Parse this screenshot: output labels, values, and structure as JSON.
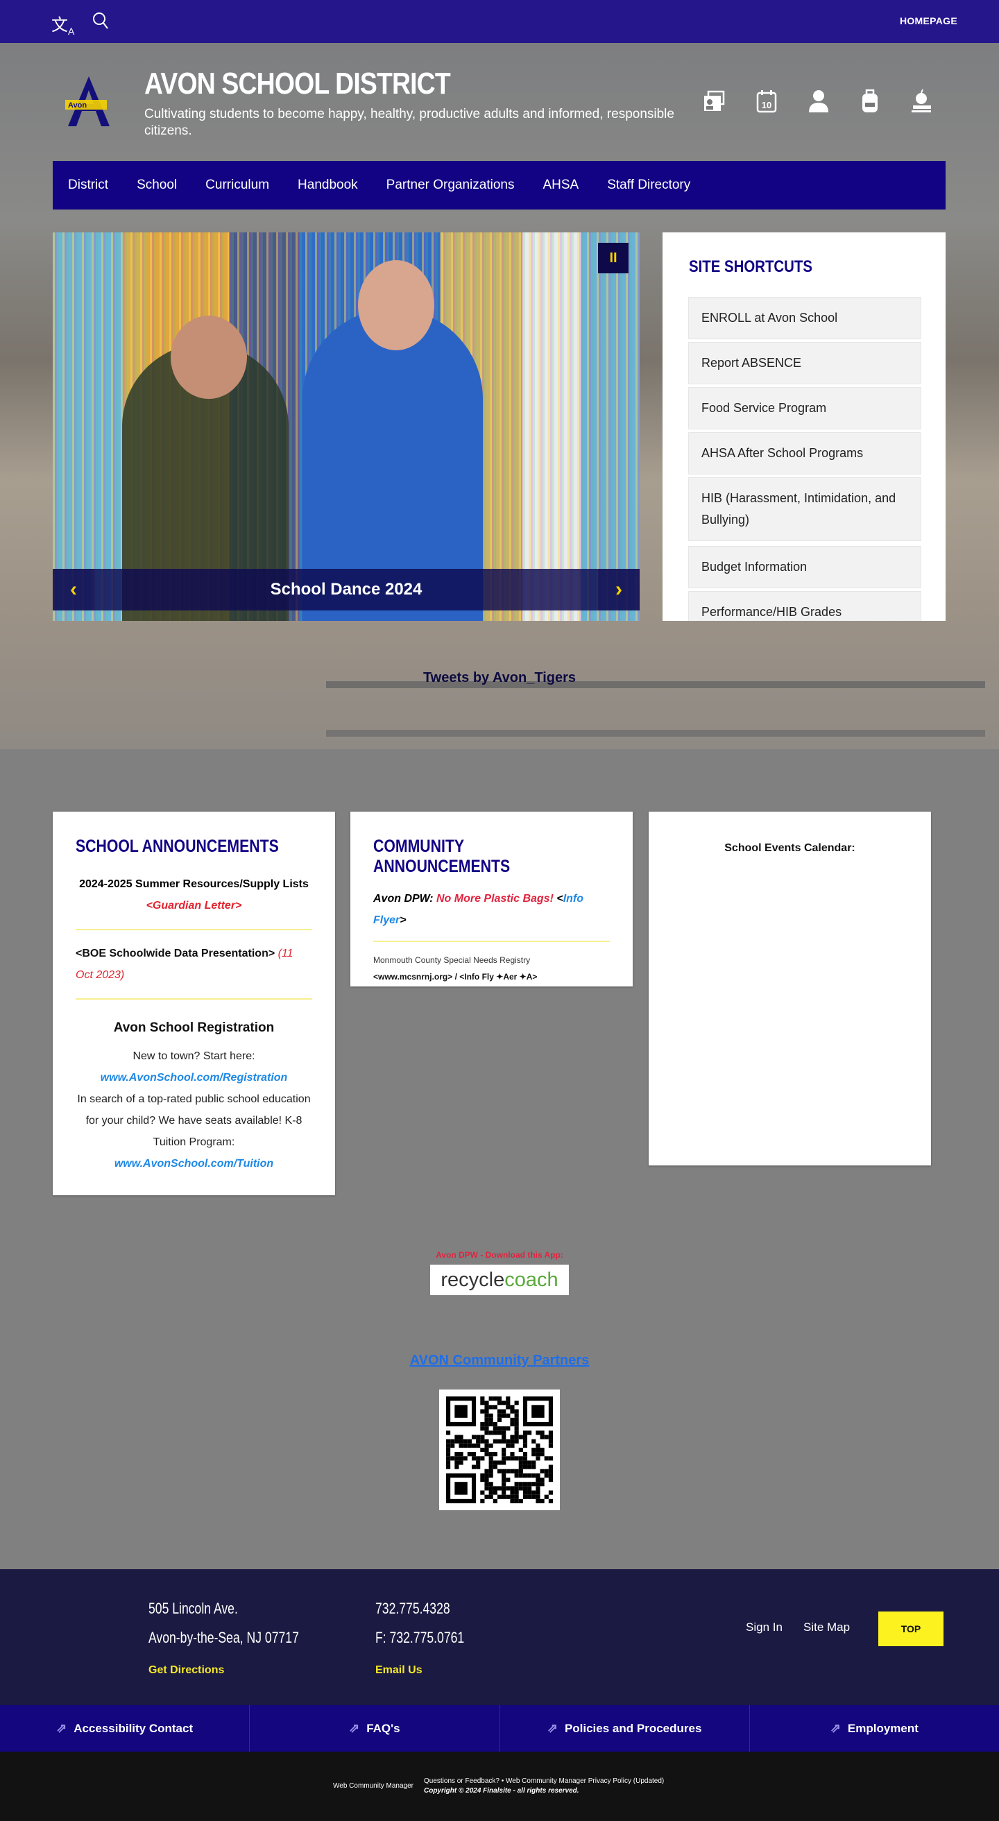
{
  "topbar": {
    "homepage": "HOMEPAGE",
    "icons": [
      "translate-icon",
      "search-icon"
    ]
  },
  "header": {
    "title": "AVON SCHOOL DISTRICT",
    "tagline": "Cultivating students to become happy, healthy, productive adults and informed, responsible citizens.",
    "logo_letter": "A",
    "logo_text": "Avon",
    "icons": [
      "directory-icon",
      "calendar-icon",
      "user-icon",
      "backpack-icon",
      "teacher-icon"
    ],
    "calendar_day": "10"
  },
  "nav": [
    "District",
    "School",
    "Curriculum",
    "Handbook",
    "Partner Organizations",
    "AHSA",
    "Staff Directory"
  ],
  "slider": {
    "caption": "School Dance 2024",
    "pause": "II",
    "prev": "‹",
    "next": "›"
  },
  "shortcuts": {
    "title": "SITE SHORTCUTS",
    "items": [
      "ENROLL at Avon School",
      "Report ABSENCE",
      "Food Service Program",
      "AHSA After School Programs",
      "HIB (Harassment, Intimidation, and Bullying)",
      "Budget Information",
      "Performance/HIB Grades"
    ]
  },
  "tweets": "Tweets by Avon_Tigers",
  "school_announcements": {
    "title": "SCHOOL ANNOUNCEMENTS",
    "supply": "2024-2025 Summer Resources/Supply Lists",
    "guardian": "<Guardian Letter>",
    "boe": "<BOE Schoolwide Data Presentation>",
    "boe_date": "(11 Oct 2023)",
    "reg_title": "Avon School Registration",
    "reg_new": "New to town? Start here:",
    "reg_link": "www.AvonSchool.com/Registration",
    "reg_text": "In search of a top-rated public school education for your child? We have seats available! K-8 Tuition Program:",
    "tuition_link": "www.AvonSchool.com/Tuition"
  },
  "community_announcements": {
    "title": "COMMUNITY ANNOUNCEMENTS",
    "dpw": "Avon DPW:",
    "bags": "No More Plastic Bags!",
    "lt": "<",
    "info": "Info Flyer",
    "gt": ">",
    "registry": "Monmouth County Special Needs Registry",
    "registry_links": "<www.mcsnrnj.org> / <Info Fly ✦Aer ✦A>"
  },
  "calendar": {
    "title": "School Events Calendar:"
  },
  "dpw_app": {
    "label": "Avon DPW - Download this App:",
    "logo_a": "recycle",
    "logo_b": "coach"
  },
  "partners": "AVON Community Partners",
  "footer": {
    "address1": "505 Lincoln Ave.",
    "address2": "Avon-by-the-Sea, NJ 07717",
    "directions": "Get Directions",
    "phone": "732.775.4328",
    "fax": "F: 732.775.0761",
    "email": "Email Us",
    "signin": "Sign In",
    "sitemap": "Site Map",
    "top": "TOP"
  },
  "footer_links": [
    "Accessibility Contact",
    "FAQ's",
    "Policies and Procedures",
    "Employment"
  ],
  "bottom": {
    "wcm": "Web Community Manager",
    "feedback": "Questions or Feedback?",
    "privacy": "Web Community Manager Privacy Policy (Updated)",
    "copyright": "Copyright © 2024 Finalsite - all rights reserved."
  },
  "colors": {
    "topbar": "#26168c",
    "nav": "#120384",
    "footer": "#1b1a42",
    "links_bar": "#13067f",
    "accent_yellow": "#fbf220",
    "link_blue": "#1e88e5",
    "red": "#e0242f"
  }
}
